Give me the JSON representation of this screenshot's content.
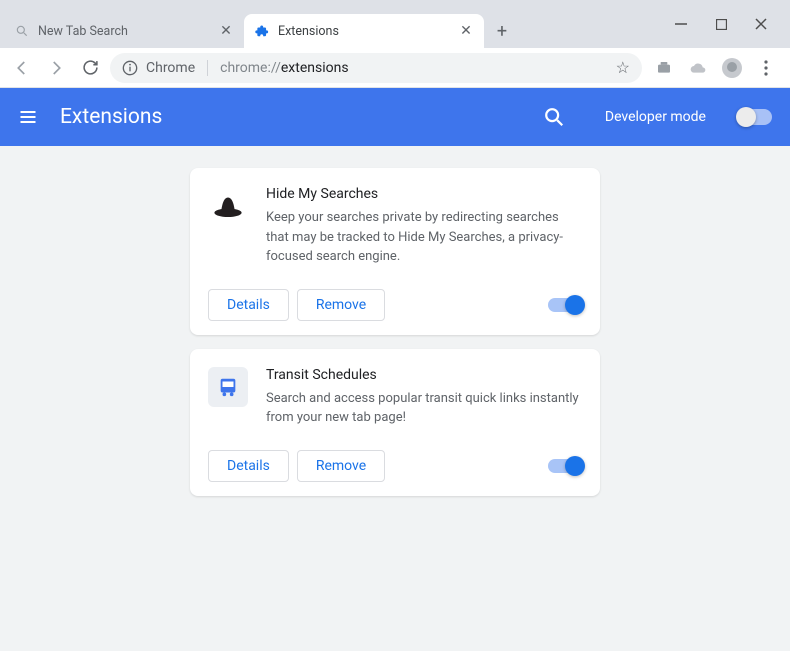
{
  "window": {
    "tabs": [
      {
        "title": "New Tab Search",
        "active": false,
        "icon": "magnifier"
      },
      {
        "title": "Extensions",
        "active": true,
        "icon": "puzzle"
      }
    ]
  },
  "toolbar": {
    "chip_label": "Chrome",
    "url_dim": "chrome://",
    "url_strong": "extensions"
  },
  "header": {
    "title": "Extensions",
    "dev_mode_label": "Developer mode",
    "dev_mode_on": false
  },
  "extensions": [
    {
      "icon": "hat",
      "name": "Hide My Searches",
      "desc": "Keep your searches private by redirecting searches that may be tracked to Hide My Searches, a privacy-focused search engine.",
      "details_label": "Details",
      "remove_label": "Remove",
      "enabled": true
    },
    {
      "icon": "bus",
      "name": "Transit Schedules",
      "desc": "Search and access popular transit quick links instantly from your new tab page!",
      "details_label": "Details",
      "remove_label": "Remove",
      "enabled": true
    }
  ]
}
